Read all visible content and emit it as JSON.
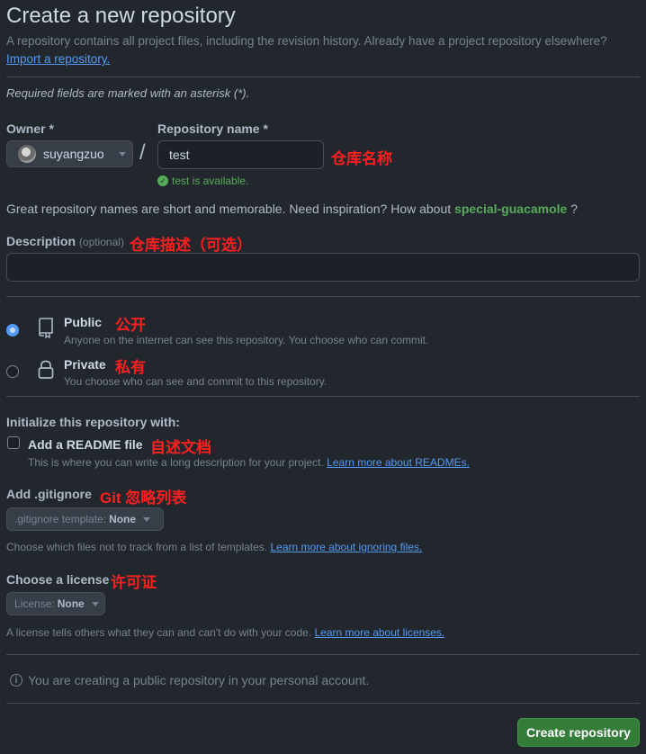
{
  "header": {
    "title": "Create a new repository",
    "subtitle": "A repository contains all project files, including the revision history. Already have a project repository elsewhere?",
    "import_link": "Import a repository."
  },
  "required_note": "Required fields are marked with an asterisk (*).",
  "owner": {
    "label": "Owner *",
    "value": "suyangzuo"
  },
  "separator": "/",
  "repo_name": {
    "label": "Repository name *",
    "value": "test",
    "annotation": "仓库名称",
    "availability": "test is available."
  },
  "inspiration": {
    "text": "Great repository names are short and memorable. Need inspiration? How about",
    "suggestion": "special-guacamole",
    "suffix": "?"
  },
  "description": {
    "label": "Description",
    "optional": "(optional)",
    "annotation": "仓库描述（可选）",
    "value": ""
  },
  "visibility": {
    "public": {
      "label": "Public",
      "annotation": "公开",
      "description": "Anyone on the internet can see this repository. You choose who can commit.",
      "selected": true
    },
    "private": {
      "label": "Private",
      "annotation": "私有",
      "description": "You choose who can see and commit to this repository.",
      "selected": false
    }
  },
  "initialize": {
    "heading": "Initialize this repository with:",
    "readme": {
      "label": "Add a README file",
      "annotation": "自述文档",
      "description": "This is where you can write a long description for your project.",
      "link": "Learn more about READMEs.",
      "checked": false
    }
  },
  "gitignore": {
    "label": "Add .gitignore",
    "annotation": "Git 忽略列表",
    "select_prefix": ".gitignore template:",
    "select_value": "None",
    "description": "Choose which files not to track from a list of templates.",
    "link": "Learn more about ignoring files."
  },
  "license": {
    "label": "Choose a license",
    "annotation": "许可证",
    "select_prefix": "License:",
    "select_value": "None",
    "description": "A license tells others what they can and can't do with your code.",
    "link": "Learn more about licenses."
  },
  "notice": "You are creating a public repository in your personal account.",
  "submit_label": "Create repository",
  "colors": {
    "background": "#22272e",
    "accent": "#539bf5",
    "success": "#57ab5a",
    "button": "#347d39",
    "annotation": "#ff1f1f"
  },
  "icons": {
    "public": "repo-icon",
    "private": "lock-icon",
    "availability": "check-circle-icon",
    "notice": "info-icon"
  }
}
